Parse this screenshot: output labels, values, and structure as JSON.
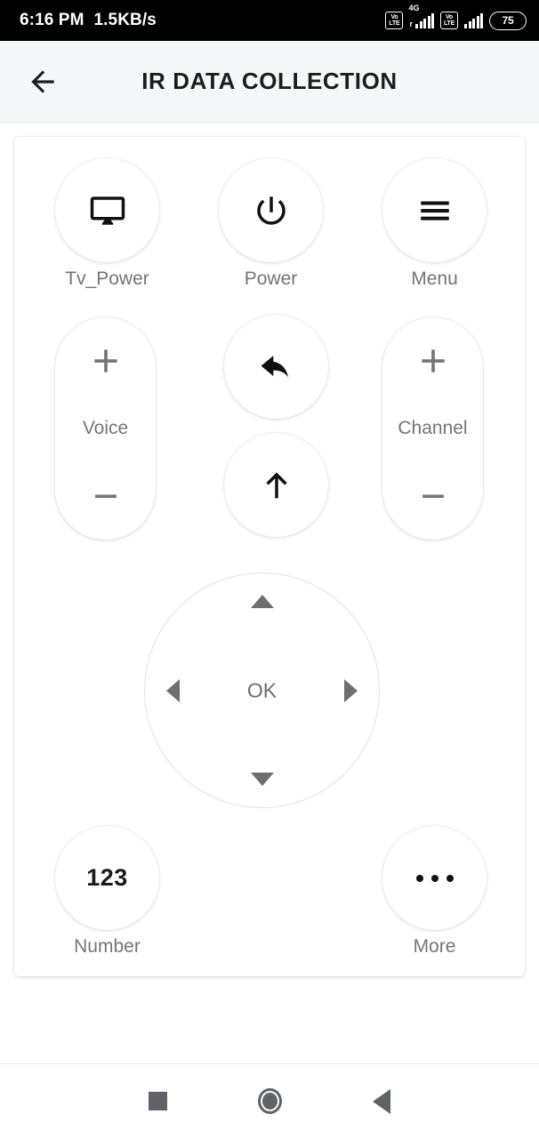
{
  "status_bar": {
    "time": "6:16 PM",
    "network_speed": "1.5KB/s",
    "sim1_volte": "VoLTE",
    "sim1_volte_top": "Vo",
    "sim1_volte_bottom": "LTE",
    "network_type": "4G",
    "sim1_roaming": "r",
    "sim2_volte_top": "Vo",
    "sim2_volte_bottom": "LTE",
    "battery_percent": "75"
  },
  "app_bar": {
    "title": "IR DATA COLLECTION",
    "back_label": "Back"
  },
  "remote": {
    "row1": [
      {
        "key": "tv_power",
        "icon": "tv-monitor-icon",
        "label": "Tv_Power"
      },
      {
        "key": "power",
        "icon": "power-icon",
        "label": "Power"
      },
      {
        "key": "menu",
        "icon": "hamburger-menu-icon",
        "label": "Menu"
      }
    ],
    "rockers": [
      {
        "key": "voice",
        "label": "Voice",
        "plus": "+",
        "minus": "–"
      },
      {
        "key": "channel",
        "label": "Channel",
        "plus": "+",
        "minus": "–"
      }
    ],
    "center": [
      {
        "key": "back",
        "icon": "reply-arrow-icon",
        "label": "Back"
      },
      {
        "key": "up",
        "icon": "arrow-up-icon",
        "label": "Up"
      }
    ],
    "dpad": {
      "ok_label": "OK",
      "up_label": "Up",
      "down_label": "Down",
      "left_label": "Left",
      "right_label": "Right"
    },
    "row_bottom": [
      {
        "key": "number",
        "text": "123",
        "label": "Number"
      },
      {
        "key": "more",
        "icon": "ellipsis-icon",
        "label": "More"
      }
    ]
  },
  "nav_bar": {
    "recents_label": "Recents",
    "home_label": "Home",
    "back_label": "Back"
  },
  "colors": {
    "status_bar_bg": "#000000",
    "app_bar_bg": "#f5f8f9",
    "page_bg": "#ffffff",
    "label_text": "#757575",
    "title_text": "#1c1c1e",
    "icon_dark": "#111111",
    "icon_grey": "#6e6e6e",
    "nav_icon": "#5f6368"
  }
}
